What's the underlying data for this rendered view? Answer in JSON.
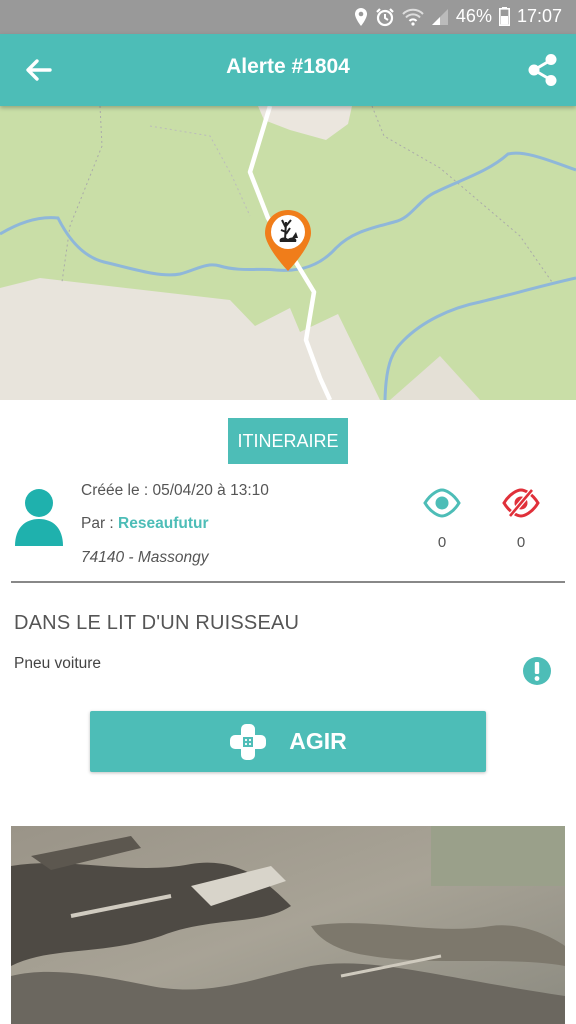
{
  "status_bar": {
    "battery": "46%",
    "time": "17:07"
  },
  "header": {
    "title": "Alerte #1804"
  },
  "route_button": "ITINERAIRE",
  "details": {
    "created_label": "Créée le : 05/04/20 à 13:10",
    "by_prefix": "Par : ",
    "author": "Reseaufutur",
    "location": "74140 - Massongy"
  },
  "stats": {
    "seen": "0",
    "not_seen": "0"
  },
  "alert": {
    "title": "DANS LE LIT D'UN RUISSEAU",
    "description": "Pneu voiture"
  },
  "act_button": "AGIR",
  "colors": {
    "accent": "#4dbdb7",
    "marker": "#f07d1a",
    "unseen": "#e0303a"
  },
  "icons": [
    "back-arrow-icon",
    "share-icon",
    "map-marker-icon",
    "avatar-icon",
    "eye-icon",
    "eye-off-icon",
    "warning-icon",
    "bandage-icon"
  ]
}
